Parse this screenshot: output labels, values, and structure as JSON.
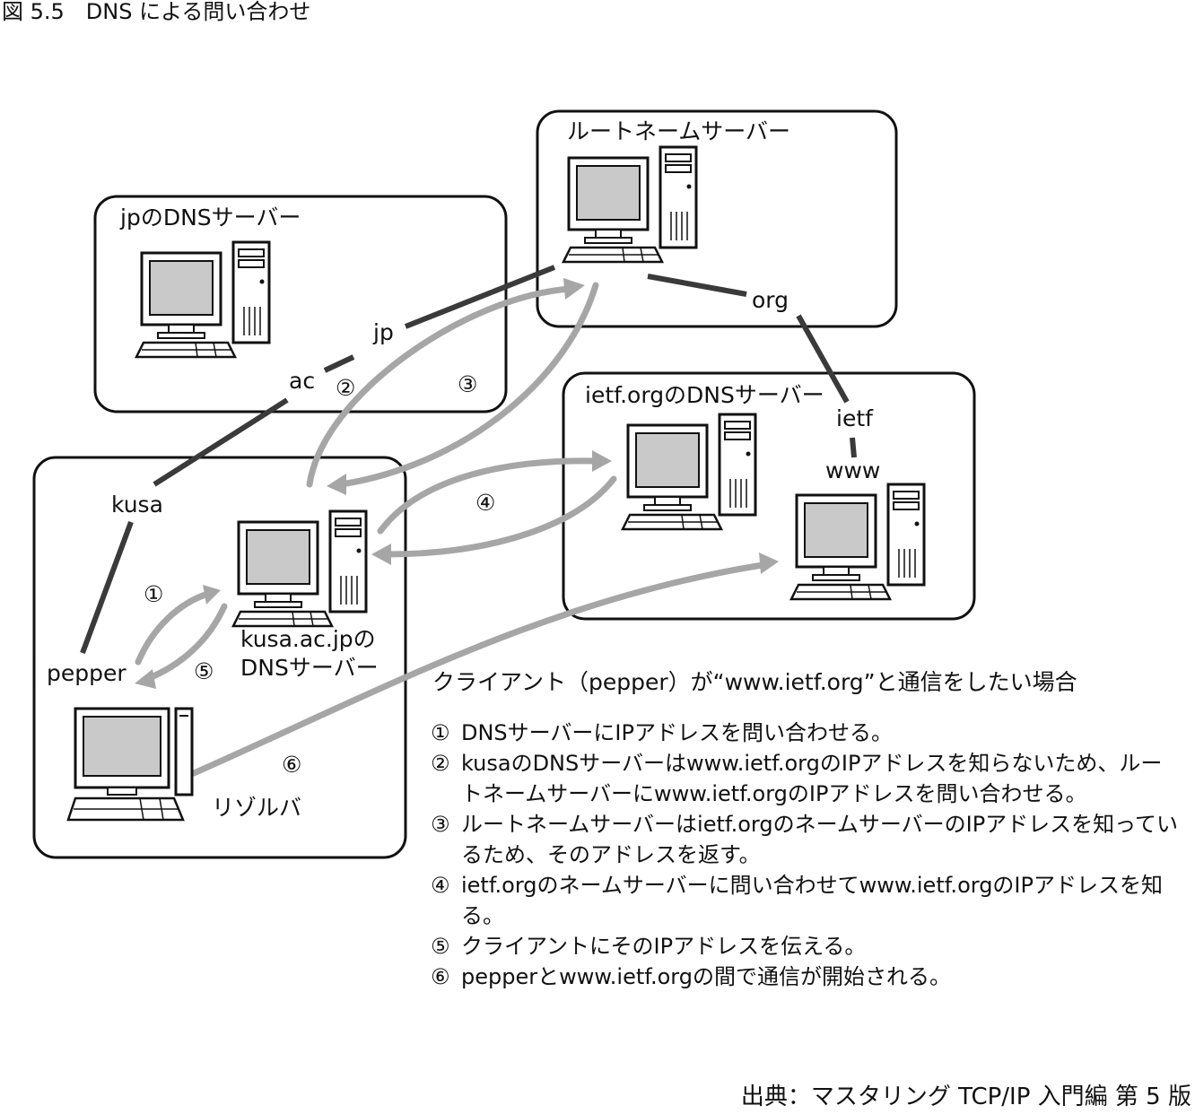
{
  "figure_title": "図 5.5　DNS による問い合わせ",
  "source_note": "出典：マスタリング TCP/IP 入門編 第 5 版",
  "boxes": {
    "root": "ルートネームサーバー",
    "jp": "jpのDNSサーバー",
    "ietf": "ietf.orgのDNSサーバー",
    "kusa_line1": "kusa.ac.jpの",
    "kusa_line2": "DNSサーバー",
    "resolver": "リゾルバ"
  },
  "tree_labels": {
    "jp": "jp",
    "ac": "ac",
    "kusa": "kusa",
    "pepper": "pepper",
    "org": "org",
    "ietf": "ietf",
    "www": "www"
  },
  "step_markers": [
    "①",
    "②",
    "③",
    "④",
    "⑤",
    "⑥"
  ],
  "scenario": "クライアント（pepper）が“www.ietf.org”と通信をしたい場合",
  "steps": [
    {
      "num": "①",
      "text": "DNSサーバーにIPアドレスを問い合わせる。"
    },
    {
      "num": "②",
      "text": "kusaのDNSサーバーはwww.ietf.orgのIPアドレスを知らないため、ルートネームサーバーにwww.ietf.orgのIPアドレスを問い合わせる。"
    },
    {
      "num": "③",
      "text": "ルートネームサーバーはietf.orgのネームサーバーのIPアドレスを知っているため、そのアドレスを返す。"
    },
    {
      "num": "④",
      "text": "ietf.orgのネームサーバーに問い合わせてwww.ietf.orgのIPアドレスを知る。"
    },
    {
      "num": "⑤",
      "text": "クライアントにそのIPアドレスを伝える。"
    },
    {
      "num": "⑥",
      "text": "pepperとwww.ietf.orgの間で通信が開始される。"
    }
  ]
}
